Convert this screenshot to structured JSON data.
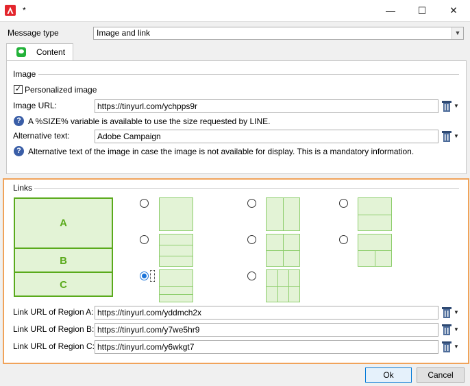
{
  "window": {
    "title": "*",
    "minimize": "—",
    "maximize": "☐",
    "close": "✕"
  },
  "message_type": {
    "label": "Message type",
    "value": "Image and link"
  },
  "tabs": [
    {
      "label": "Content"
    }
  ],
  "image_section": {
    "title": "Image",
    "personalized_label": "Personalized image",
    "personalized_checked": true,
    "url_label": "Image URL:",
    "url_value": "https://tinyurl.com/ychpps9r",
    "url_help": "A %SIZE% variable is available to use the size requested by LINE.",
    "alt_label": "Alternative text:",
    "alt_value": "Adobe Campaign",
    "alt_help": "Alternative text of the image in case the image is not available for display. This is a mandatory information."
  },
  "links_section": {
    "title": "Links",
    "preview_regions": [
      "A",
      "B",
      "C"
    ],
    "selected_layout": 6,
    "links": [
      {
        "label": "Link URL of Region A:",
        "value": "https://tinyurl.com/yddmch2x"
      },
      {
        "label": "Link URL of Region B:",
        "value": "https://tinyurl.com/y7we5hr9"
      },
      {
        "label": "Link URL of Region C:",
        "value": "https://tinyurl.com/y6wkgt7"
      }
    ]
  },
  "buttons": {
    "ok": "Ok",
    "cancel": "Cancel"
  },
  "colors": {
    "accent": "#f0a35a",
    "region": "#5aaa1c",
    "region_fill": "#e3f3d6",
    "app_icon": "#e3262d",
    "line_icon": "#23b23a"
  }
}
